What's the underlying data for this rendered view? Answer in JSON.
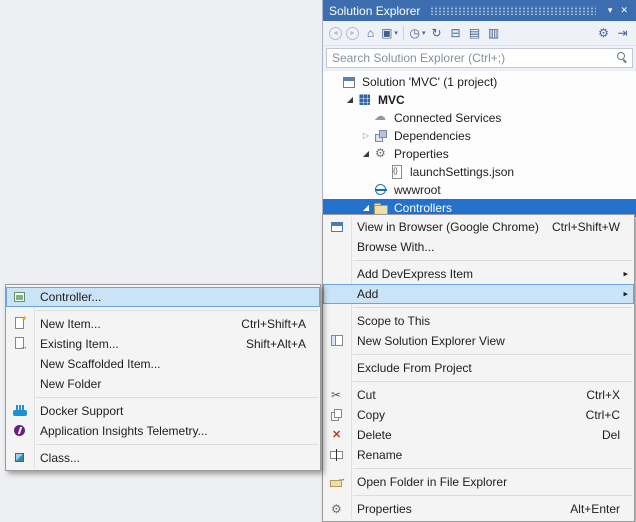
{
  "colors": {
    "titlebar_blue": "#3b6daf",
    "selection_blue": "#2372ce",
    "menu_highlight": "#cbe3f7",
    "menu_highlight_border": "#6ca6d9",
    "menu_background": "#f4f4f4",
    "panel_chrome_background": "#eef2f8",
    "desktop_background": "#eeeff2"
  },
  "glyphs": {
    "submenu_arrow": "▸",
    "tree_expanded": "◢",
    "tree_collapsed": "▷",
    "dropdown_caret": "▾"
  },
  "solution_explorer": {
    "title": "Solution Explorer",
    "search_placeholder": "Search Solution Explorer (Ctrl+;)",
    "titlebar_icons": [
      {
        "name": "window-position-icon",
        "glyph": "▾"
      },
      {
        "name": "close-icon",
        "glyph": "✕"
      }
    ],
    "toolbar": [
      {
        "name": "back-icon",
        "glyph": "◄",
        "disabled": true
      },
      {
        "name": "forward-icon",
        "glyph": "►",
        "disabled": true
      },
      {
        "name": "home-icon",
        "glyph": "⌂"
      },
      {
        "name": "switch-views-icon",
        "glyph": "▣",
        "caret": true
      },
      {
        "type": "separator"
      },
      {
        "name": "pending-changes-filter-icon",
        "glyph": "◷",
        "caret": true
      },
      {
        "name": "sync-with-active-document-icon",
        "glyph": "↻"
      },
      {
        "name": "collapse-all-icon",
        "glyph": "⊟"
      },
      {
        "name": "show-all-files-icon",
        "glyph": "▤"
      },
      {
        "name": "properties-pages-icon",
        "glyph": "▥"
      },
      {
        "type": "spacer"
      },
      {
        "name": "wrench-icon",
        "glyph": "⚙"
      },
      {
        "name": "preview-selected-items-icon",
        "glyph": "⇥"
      }
    ],
    "tree": [
      {
        "label": "Solution 'MVC' (1 project)",
        "icon": "solution-icon",
        "level": 0,
        "expand": "none"
      },
      {
        "label": "MVC",
        "icon": "project-icon",
        "level": 1,
        "expand": "expanded",
        "bold": true
      },
      {
        "label": "Connected Services",
        "icon": "connected-services-icon",
        "level": 2,
        "expand": "none"
      },
      {
        "label": "Dependencies",
        "icon": "dependencies-icon",
        "level": 2,
        "expand": "collapsed"
      },
      {
        "label": "Properties",
        "icon": "wrench-icon",
        "level": 2,
        "expand": "expanded"
      },
      {
        "label": "launchSettings.json",
        "icon": "json-file-icon",
        "level": 3,
        "expand": "none"
      },
      {
        "label": "wwwroot",
        "icon": "globe-icon",
        "level": 2,
        "expand": "none"
      },
      {
        "label": "Controllers",
        "icon": "folder-icon",
        "level": 2,
        "expand": "expanded",
        "selected": true
      }
    ]
  },
  "context_menu": {
    "items": [
      {
        "label": "View in Browser (Google Chrome)",
        "shortcut": "Ctrl+Shift+W",
        "icon": "browser-icon"
      },
      {
        "label": "Browse With..."
      },
      {
        "separator": true
      },
      {
        "label": "Add DevExpress Item",
        "submenu": true
      },
      {
        "label": "Add",
        "submenu": true,
        "highlighted": true
      },
      {
        "separator": true
      },
      {
        "label": "Scope to This"
      },
      {
        "label": "New Solution Explorer View",
        "icon": "solution-view-icon"
      },
      {
        "separator": true
      },
      {
        "label": "Exclude From Project"
      },
      {
        "separator": true
      },
      {
        "label": "Cut",
        "shortcut": "Ctrl+X",
        "icon": "cut-icon"
      },
      {
        "label": "Copy",
        "shortcut": "Ctrl+C",
        "icon": "copy-icon"
      },
      {
        "label": "Delete",
        "shortcut": "Del",
        "icon": "delete-icon"
      },
      {
        "label": "Rename",
        "icon": "rename-icon"
      },
      {
        "separator": true
      },
      {
        "label": "Open Folder in File Explorer",
        "icon": "open-folder-icon"
      },
      {
        "separator": true
      },
      {
        "label": "Properties",
        "shortcut": "Alt+Enter",
        "icon": "wrench-icon"
      }
    ]
  },
  "add_submenu": {
    "items": [
      {
        "label": "Controller...",
        "icon": "controller-icon",
        "highlighted": true
      },
      {
        "separator": true
      },
      {
        "label": "New Item...",
        "shortcut": "Ctrl+Shift+A",
        "icon": "new-item-icon"
      },
      {
        "label": "Existing Item...",
        "shortcut": "Shift+Alt+A",
        "icon": "existing-item-icon"
      },
      {
        "label": "New Scaffolded Item..."
      },
      {
        "label": "New Folder"
      },
      {
        "separator": true
      },
      {
        "label": "Docker Support",
        "icon": "docker-icon"
      },
      {
        "label": "Application Insights Telemetry...",
        "icon": "app-insights-icon"
      },
      {
        "separator": true
      },
      {
        "label": "Class...",
        "icon": "class-icon"
      }
    ]
  }
}
